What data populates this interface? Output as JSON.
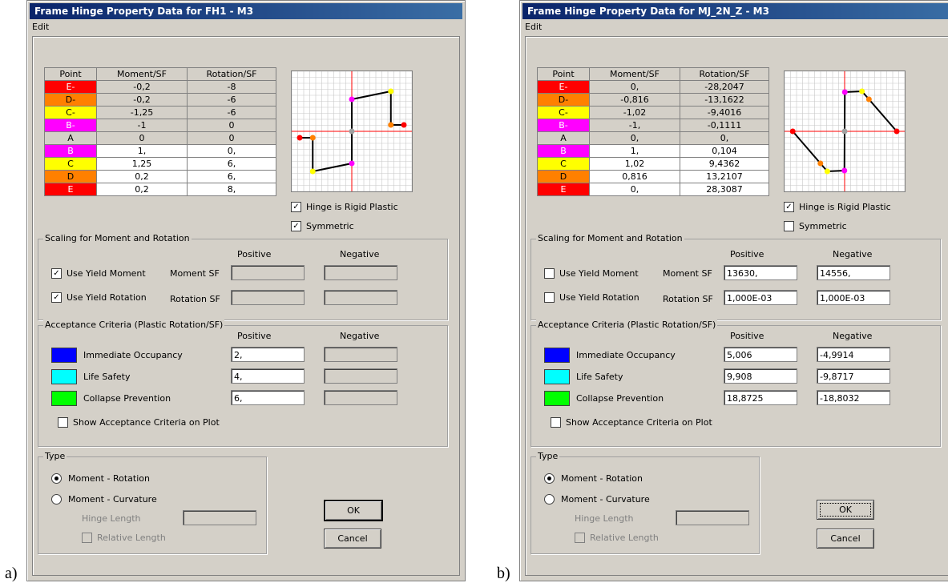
{
  "captions": {
    "a": "a)",
    "b": "b)"
  },
  "colors": {
    "E": "#ff0000",
    "D": "#ff8000",
    "C": "#ffff00",
    "B": "#ff00ff",
    "A": "#d4d0c8",
    "io": "#0000ff",
    "ls": "#00ffff",
    "cp": "#00ff00"
  },
  "windows": [
    {
      "title": "Frame Hinge Property Data for FH1 - M3",
      "menu": "Edit",
      "headers": [
        "Point",
        "Moment/SF",
        "Rotation/SF"
      ],
      "rows": [
        {
          "pt": "E-",
          "m": "-0,2",
          "r": "-8"
        },
        {
          "pt": "D-",
          "m": "-0,2",
          "r": "-6"
        },
        {
          "pt": "C-",
          "m": "-1,25",
          "r": "-6"
        },
        {
          "pt": "B-",
          "m": "-1",
          "r": "0"
        },
        {
          "pt": "A",
          "m": "0",
          "r": "0"
        },
        {
          "pt": "B",
          "m": "1,",
          "r": "0,"
        },
        {
          "pt": "C",
          "m": "1,25",
          "r": "6,"
        },
        {
          "pt": "D",
          "m": "0,2",
          "r": "6,"
        },
        {
          "pt": "E",
          "m": "0,2",
          "r": "8,"
        }
      ],
      "rigid_label": "Hinge is Rigid Plastic",
      "rigid_checked": "✓",
      "symmetric_label": "Symmetric",
      "symmetric_checked": "✓",
      "scaling_title": "Scaling for Moment and Rotation",
      "positive": "Positive",
      "negative": "Negative",
      "use_yield_moment": "Use Yield Moment",
      "yield_moment_checked": "✓",
      "use_yield_rotation": "Use Yield Rotation",
      "yield_rotation_checked": "✓",
      "moment_sf": "Moment SF",
      "rotation_sf": "Rotation SF",
      "moment_sf_pos": "",
      "moment_sf_neg": "",
      "rotation_sf_pos": "",
      "rotation_sf_neg": "",
      "acc_title": "Acceptance Criteria (Plastic Rotation/SF)",
      "io": "Immediate Occupancy",
      "ls": "Life Safety",
      "cp": "Collapse Prevention",
      "io_pos": "2,",
      "ls_pos": "4,",
      "cp_pos": "6,",
      "io_neg": "",
      "ls_neg": "",
      "cp_neg": "",
      "show_acc": "Show Acceptance Criteria on Plot",
      "type_title": "Type",
      "type_mr": "Moment - Rotation",
      "type_mc": "Moment - Curvature",
      "hinge_length": "Hinge Length",
      "relative_length": "Relative Length",
      "ok": "OK",
      "cancel": "Cancel"
    },
    {
      "title": "Frame Hinge Property Data for MJ_2N_Z - M3",
      "menu": "Edit",
      "headers": [
        "Point",
        "Moment/SF",
        "Rotation/SF"
      ],
      "rows": [
        {
          "pt": "E-",
          "m": "0,",
          "r": "-28,2047"
        },
        {
          "pt": "D-",
          "m": "-0,816",
          "r": "-13,1622"
        },
        {
          "pt": "C-",
          "m": "-1,02",
          "r": "-9,4016"
        },
        {
          "pt": "B-",
          "m": "-1,",
          "r": "-0,1111"
        },
        {
          "pt": "A",
          "m": "0,",
          "r": "0,"
        },
        {
          "pt": "B",
          "m": "1,",
          "r": "0,104"
        },
        {
          "pt": "C",
          "m": "1,02",
          "r": "9,4362"
        },
        {
          "pt": "D",
          "m": "0,816",
          "r": "13,2107"
        },
        {
          "pt": "E",
          "m": "0,",
          "r": "28,3087"
        }
      ],
      "rigid_label": "Hinge is Rigid Plastic",
      "rigid_checked": "✓",
      "symmetric_label": "Symmetric",
      "symmetric_checked": "",
      "scaling_title": "Scaling for Moment and Rotation",
      "positive": "Positive",
      "negative": "Negative",
      "use_yield_moment": "Use Yield Moment",
      "yield_moment_checked": "",
      "use_yield_rotation": "Use Yield Rotation",
      "yield_rotation_checked": "",
      "moment_sf": "Moment SF",
      "rotation_sf": "Rotation SF",
      "moment_sf_pos": "13630,",
      "moment_sf_neg": "14556,",
      "rotation_sf_pos": "1,000E-03",
      "rotation_sf_neg": "1,000E-03",
      "acc_title": "Acceptance Criteria (Plastic Rotation/SF)",
      "io": "Immediate Occupancy",
      "ls": "Life Safety",
      "cp": "Collapse Prevention",
      "io_pos": "5,006",
      "ls_pos": "9,908",
      "cp_pos": "18,8725",
      "io_neg": "-4,9914",
      "ls_neg": "-9,8717",
      "cp_neg": "-18,8032",
      "show_acc": "Show Acceptance Criteria on Plot",
      "type_title": "Type",
      "type_mr": "Moment - Rotation",
      "type_mc": "Moment - Curvature",
      "hinge_length": "Hinge Length",
      "relative_length": "Relative Length",
      "ok": "OK",
      "cancel": "Cancel"
    }
  ]
}
